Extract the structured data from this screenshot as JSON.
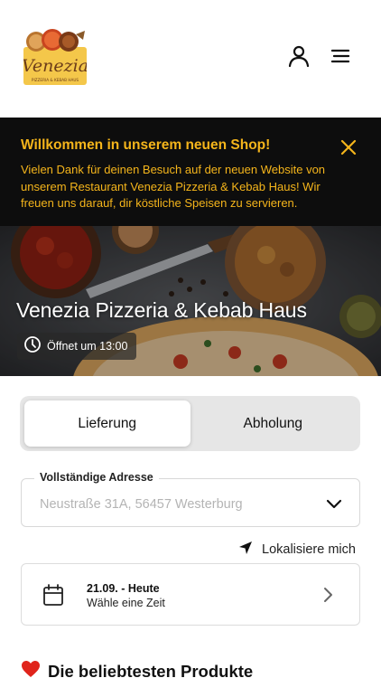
{
  "header": {
    "logo_text": "Venezia",
    "logo_sub": "PIZZERIA & KEBAB HAUS",
    "user_icon": "user-icon",
    "menu_icon": "hamburger-menu-icon"
  },
  "banner": {
    "title": "Willkommen in unserem neuen Shop!",
    "text": "Vielen Dank für deinen Besuch auf der neuen Website von unserem Restaurant Venezia Pizzeria & Kebab Haus! Wir freuen uns darauf, dir köstliche Speisen zu servieren.",
    "close_icon": "close-icon",
    "accent": "#f5b51b",
    "background": "#0d0d0d"
  },
  "hero": {
    "title": "Venezia Pizzeria & Kebab Haus",
    "open_text": "Öffnet um 13:00",
    "clock_icon": "clock-icon"
  },
  "order_mode": {
    "options": [
      "Lieferung",
      "Abholung"
    ],
    "selected": "Lieferung"
  },
  "address": {
    "label": "Vollständige Adresse",
    "value": "Neustraße 31A, 56457 Westerburg",
    "chevron_icon": "chevron-down-icon"
  },
  "locate": {
    "label": "Lokalisiere mich",
    "icon": "location-arrow-icon"
  },
  "time": {
    "date": "21.09. - Heute",
    "hint": "Wähle eine Zeit",
    "calendar_icon": "calendar-icon",
    "chevron_icon": "chevron-right-icon"
  },
  "popular": {
    "heading": "Die beliebtesten Produkte",
    "icon": "heart-icon"
  }
}
